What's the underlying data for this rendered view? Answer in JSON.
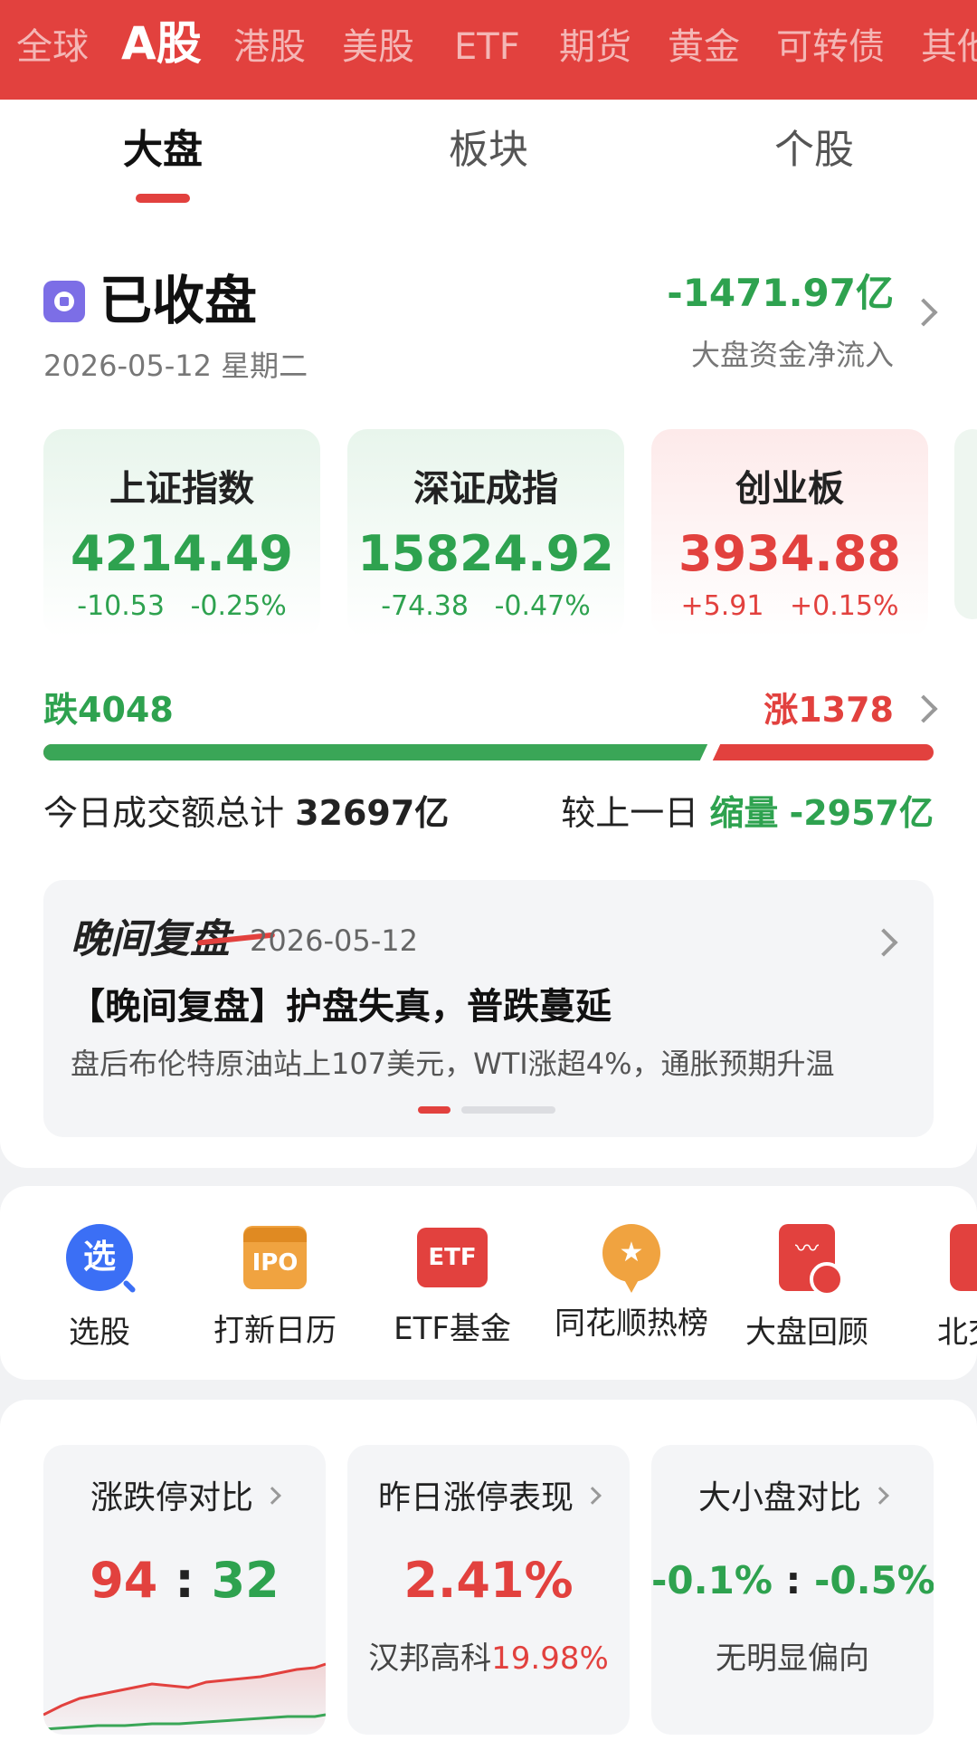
{
  "markets": {
    "items": [
      {
        "label": "全球",
        "active": false
      },
      {
        "label": "A股",
        "active": true
      },
      {
        "label": "港股",
        "active": false
      },
      {
        "label": "美股",
        "active": false
      },
      {
        "label": "ETF",
        "active": false
      },
      {
        "label": "期货",
        "active": false
      },
      {
        "label": "黄金",
        "active": false
      },
      {
        "label": "可转债",
        "active": false
      },
      {
        "label": "其他",
        "active": false
      }
    ]
  },
  "tabs": {
    "items": [
      {
        "label": "大盘",
        "active": true
      },
      {
        "label": "板块",
        "active": false
      },
      {
        "label": "个股",
        "active": false
      }
    ]
  },
  "status": {
    "title": "已收盘",
    "date": "2026-05-12 星期二",
    "net_flow_value": "-1471.97亿",
    "net_flow_label": "大盘资金净流入"
  },
  "indices": [
    {
      "name": "上证指数",
      "price": "4214.49",
      "change": "-10.53",
      "pct": "-0.25%",
      "trend": "down"
    },
    {
      "name": "深证成指",
      "price": "15824.92",
      "change": "-74.38",
      "pct": "-0.47%",
      "trend": "down"
    },
    {
      "name": "创业板",
      "price": "3934.88",
      "change": "+5.91",
      "pct": "+0.15%",
      "trend": "up"
    }
  ],
  "breadth": {
    "fall_label": "跌4048",
    "rise_label": "涨1378",
    "fall_count": 4048,
    "rise_count": 1378
  },
  "turnover": {
    "label": "今日成交额总计",
    "value": "32697亿",
    "compare_label": "较上一日",
    "compare_status": "缩量",
    "compare_value": "-2957亿"
  },
  "review": {
    "logo": "晚间复盘",
    "date": "2026-05-12",
    "title": "【晚间复盘】护盘失真，普跌蔓延",
    "summary": "盘后布伦特原油站上107美元，WTI涨超4%，通胀预期升温"
  },
  "quick_access": {
    "items": [
      {
        "label": "选股",
        "icon": "stock-picker-icon",
        "glyph": "选"
      },
      {
        "label": "打新日历",
        "icon": "ipo-calendar-icon",
        "glyph": "IPO"
      },
      {
        "label": "ETF基金",
        "icon": "etf-fund-icon",
        "glyph": "ETF"
      },
      {
        "label": "同花顺热榜",
        "icon": "hot-list-icon",
        "glyph": "★"
      },
      {
        "label": "大盘回顾",
        "icon": "market-review-icon",
        "glyph": "〰"
      },
      {
        "label": "北交所",
        "icon": "bse-icon",
        "glyph": ""
      }
    ]
  },
  "stats": {
    "limit": {
      "title": "涨跌停对比",
      "up": "94",
      "sep": ":",
      "down": "32"
    },
    "yesterday": {
      "title": "昨日涨停表现",
      "value": "2.41%",
      "stock": "汉邦高科",
      "stock_pct": "19.98%"
    },
    "size": {
      "title": "大小盘对比",
      "large": "-0.1%",
      "sep": ":",
      "small": "-0.5%",
      "note": "无明显偏向"
    }
  },
  "colors": {
    "brand_red": "#e2413e",
    "down_green": "#2ea24f",
    "up_red": "#e2413e"
  }
}
